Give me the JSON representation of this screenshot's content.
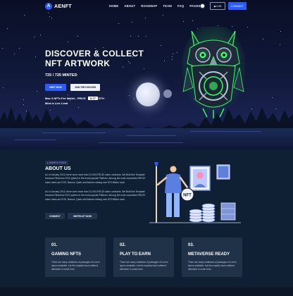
{
  "brand": {
    "name": "AENFT",
    "logo_glyph": "A",
    "accent": "#2b5cff"
  },
  "nav": {
    "items": [
      "HOME",
      "ABOUT",
      "ROADMAP",
      "TEAM",
      "FAQ",
      "PAGES"
    ],
    "wallet_label": "0.99",
    "connect_label": "CONNECT"
  },
  "hero": {
    "title": "DISCOVER & COLLECT NFT ARTWORK",
    "minted": "725 / 725 MINTED",
    "mint_label": "MINT NOW",
    "discord_label": "JOIN THE DISCORD",
    "max_per_wallet": "Max 3 NFTs Per Wallet , PRICE",
    "price_value": "0.77",
    "price_unit": "ETH",
    "mint_live": "Mint is Live Limit"
  },
  "about": {
    "pill": "SAMPLE VIDEO",
    "title": "ABOUT US",
    "p1": "As of January 2013, there were more than 31,000 ERC20 token contracts. We Built this Template because Ethereum ECS system is the most popular Platform. Among the most successful ERC20 token sales are EOS, Bancor, Qash and Bankex raising over $73 Million each.",
    "p2": "As of January 2013, there were more than 31,000 ERC20 token contracts. We Built this Template because Ethereum ECS system is the most popular Platform. Among the most successful ERC20 token sales are EOS, Bancor, Qash and Bankex raising over $73 Million each.",
    "connect_label": "CONNECT",
    "whitelist_label": "WHITELIST NOW",
    "nft_tag": "NFT"
  },
  "cards": [
    {
      "num": "01.",
      "title": "GAMING NFTS",
      "text": "There are many variations of passages of Lorem Ipsum available, but the majority have suffered alteration in some form."
    },
    {
      "num": "02.",
      "title": "PLAY TO EARN",
      "text": "There are many variations of passages of Lorem Ipsum available, but the majority have suffered alteration in some form."
    },
    {
      "num": "03.",
      "title": "METAVERSE READY",
      "text": "There are many variations of passages of Lorem Ipsum available, but the majority have suffered alteration in some form."
    }
  ]
}
